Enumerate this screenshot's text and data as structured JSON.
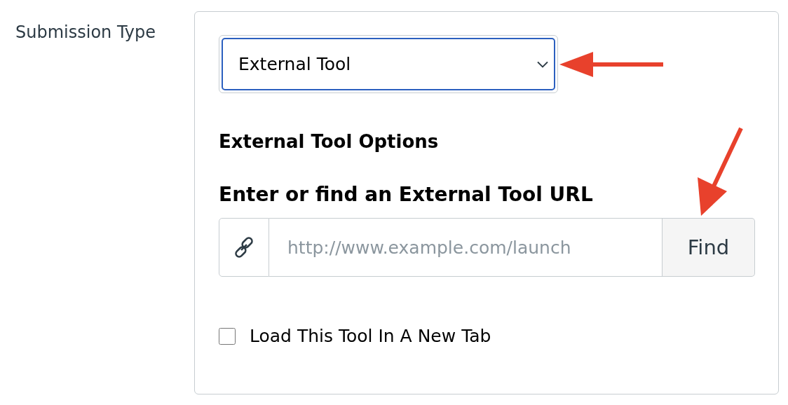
{
  "field_label": "Submission Type",
  "submission_select": {
    "value": "External Tool"
  },
  "options_heading": "External Tool Options",
  "url_heading": "Enter or find an External Tool URL",
  "url_field": {
    "placeholder": "http://www.example.com/launch"
  },
  "find_button": "Find",
  "new_tab_checkbox": {
    "label": "Load This Tool In A New Tab",
    "checked": false
  }
}
